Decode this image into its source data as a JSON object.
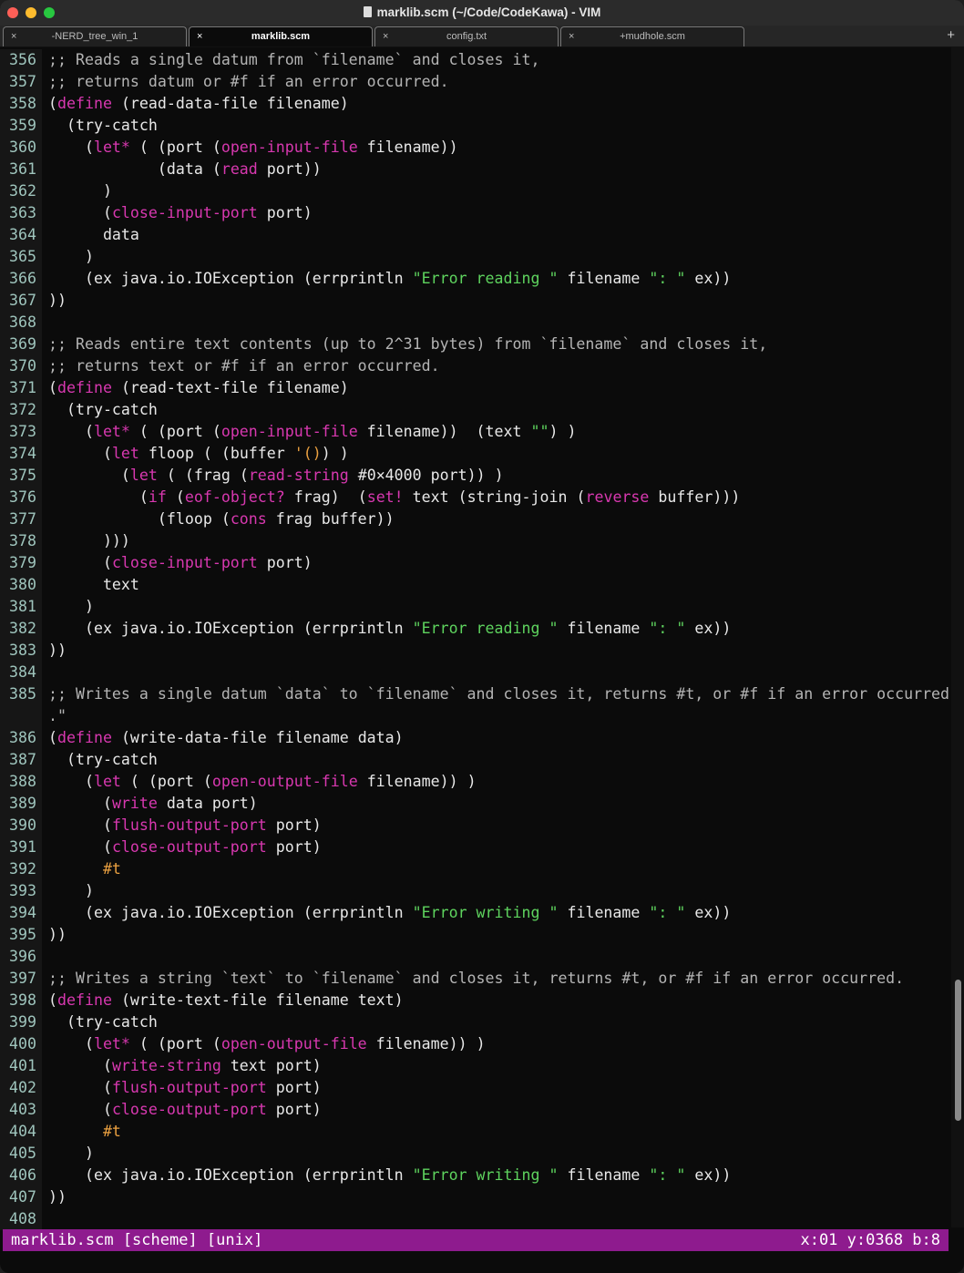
{
  "window": {
    "title": "marklib.scm (~/Code/CodeKawa) - VIM"
  },
  "tabs": [
    {
      "label": "-NERD_tree_win_1",
      "close": "×",
      "active": false
    },
    {
      "label": "marklib.scm",
      "close": "×",
      "active": true
    },
    {
      "label": "config.txt",
      "close": "×",
      "active": false
    },
    {
      "label": "+mudhole.scm",
      "close": "×",
      "active": false
    }
  ],
  "new_tab_label": "+",
  "colors": {
    "statusbar": "#8e1b8e",
    "keyword": "#d838b0",
    "string": "#5ed35e",
    "constant": "#eaa040",
    "comment": "#b4b4b4"
  },
  "scroll": {
    "thumb_start_fraction": 0.79,
    "thumb_size_fraction": 0.12
  },
  "lines": [
    {
      "n": "356",
      "t": [
        [
          "c",
          ";; Reads a single datum from `filename` and closes it,"
        ]
      ]
    },
    {
      "n": "357",
      "t": [
        [
          "c",
          ";; returns datum or #f if an error occurred."
        ]
      ]
    },
    {
      "n": "358",
      "t": [
        [
          "n",
          "("
        ],
        [
          "k",
          "define"
        ],
        [
          "n",
          " (read-data-file filename)"
        ]
      ]
    },
    {
      "n": "359",
      "t": [
        [
          "n",
          "  (try-catch"
        ]
      ]
    },
    {
      "n": "360",
      "t": [
        [
          "n",
          "    ("
        ],
        [
          "k",
          "let*"
        ],
        [
          "n",
          " ( (port ("
        ],
        [
          "k",
          "open-input-file"
        ],
        [
          "n",
          " filename))"
        ]
      ]
    },
    {
      "n": "361",
      "t": [
        [
          "n",
          "            (data ("
        ],
        [
          "k",
          "read"
        ],
        [
          "n",
          " port))"
        ]
      ]
    },
    {
      "n": "362",
      "t": [
        [
          "n",
          "      )"
        ]
      ]
    },
    {
      "n": "363",
      "t": [
        [
          "n",
          "      ("
        ],
        [
          "k",
          "close-input-port"
        ],
        [
          "n",
          " port)"
        ]
      ]
    },
    {
      "n": "364",
      "t": [
        [
          "n",
          "      data"
        ]
      ]
    },
    {
      "n": "365",
      "t": [
        [
          "n",
          "    )"
        ]
      ]
    },
    {
      "n": "366",
      "t": [
        [
          "n",
          "    (ex java.io.IOException (errprintln "
        ],
        [
          "s",
          "\"Error reading \""
        ],
        [
          "n",
          " filename "
        ],
        [
          "s",
          "\": \""
        ],
        [
          "n",
          " ex))"
        ]
      ]
    },
    {
      "n": "367",
      "t": [
        [
          "n",
          "))"
        ]
      ]
    },
    {
      "n": "368",
      "t": []
    },
    {
      "n": "369",
      "t": [
        [
          "c",
          ";; Reads entire text contents (up to 2^31 bytes) from `filename` and closes it,"
        ]
      ]
    },
    {
      "n": "370",
      "t": [
        [
          "c",
          ";; returns text or #f if an error occurred."
        ]
      ]
    },
    {
      "n": "371",
      "t": [
        [
          "n",
          "("
        ],
        [
          "k",
          "define"
        ],
        [
          "n",
          " (read-text-file filename)"
        ]
      ]
    },
    {
      "n": "372",
      "t": [
        [
          "n",
          "  (try-catch"
        ]
      ]
    },
    {
      "n": "373",
      "t": [
        [
          "n",
          "    ("
        ],
        [
          "k",
          "let*"
        ],
        [
          "n",
          " ( (port ("
        ],
        [
          "k",
          "open-input-file"
        ],
        [
          "n",
          " filename))  (text "
        ],
        [
          "s",
          "\"\""
        ],
        [
          "n",
          ") )"
        ]
      ]
    },
    {
      "n": "374",
      "t": [
        [
          "n",
          "      ("
        ],
        [
          "k",
          "let"
        ],
        [
          "n",
          " floop ( (buffer "
        ],
        [
          "o",
          "'()"
        ],
        [
          "n",
          ") )"
        ]
      ]
    },
    {
      "n": "375",
      "t": [
        [
          "n",
          "        ("
        ],
        [
          "k",
          "let"
        ],
        [
          "n",
          " ( (frag ("
        ],
        [
          "k",
          "read-string"
        ],
        [
          "n",
          " #0×4000 port)) )"
        ]
      ]
    },
    {
      "n": "376",
      "t": [
        [
          "n",
          "          ("
        ],
        [
          "k",
          "if"
        ],
        [
          "n",
          " ("
        ],
        [
          "k",
          "eof-object?"
        ],
        [
          "n",
          " frag)  ("
        ],
        [
          "k",
          "set!"
        ],
        [
          "n",
          " text (string-join ("
        ],
        [
          "k",
          "reverse"
        ],
        [
          "n",
          " buffer)))"
        ]
      ]
    },
    {
      "n": "377",
      "t": [
        [
          "n",
          "            (floop ("
        ],
        [
          "k",
          "cons"
        ],
        [
          "n",
          " frag buffer))"
        ]
      ]
    },
    {
      "n": "378",
      "t": [
        [
          "n",
          "      )))"
        ]
      ]
    },
    {
      "n": "379",
      "t": [
        [
          "n",
          "      ("
        ],
        [
          "k",
          "close-input-port"
        ],
        [
          "n",
          " port)"
        ]
      ]
    },
    {
      "n": "380",
      "t": [
        [
          "n",
          "      text"
        ]
      ]
    },
    {
      "n": "381",
      "t": [
        [
          "n",
          "    )"
        ]
      ]
    },
    {
      "n": "382",
      "t": [
        [
          "n",
          "    (ex java.io.IOException (errprintln "
        ],
        [
          "s",
          "\"Error reading \""
        ],
        [
          "n",
          " filename "
        ],
        [
          "s",
          "\": \""
        ],
        [
          "n",
          " ex))"
        ]
      ]
    },
    {
      "n": "383",
      "t": [
        [
          "n",
          "))"
        ]
      ]
    },
    {
      "n": "384",
      "t": []
    },
    {
      "n": "385",
      "t": [
        [
          "c",
          ";; Writes a single datum `data` to `filename` and closes it, returns #t, or #f if an error occurred"
        ]
      ]
    },
    {
      "n": "",
      "t": [
        [
          "c",
          ".\""
        ]
      ]
    },
    {
      "n": "386",
      "t": [
        [
          "n",
          "("
        ],
        [
          "k",
          "define"
        ],
        [
          "n",
          " (write-data-file filename data)"
        ]
      ]
    },
    {
      "n": "387",
      "t": [
        [
          "n",
          "  (try-catch"
        ]
      ]
    },
    {
      "n": "388",
      "t": [
        [
          "n",
          "    ("
        ],
        [
          "k",
          "let"
        ],
        [
          "n",
          " ( (port ("
        ],
        [
          "k",
          "open-output-file"
        ],
        [
          "n",
          " filename)) )"
        ]
      ]
    },
    {
      "n": "389",
      "t": [
        [
          "n",
          "      ("
        ],
        [
          "k",
          "write"
        ],
        [
          "n",
          " data port)"
        ]
      ]
    },
    {
      "n": "390",
      "t": [
        [
          "n",
          "      ("
        ],
        [
          "k",
          "flush-output-port"
        ],
        [
          "n",
          " port)"
        ]
      ]
    },
    {
      "n": "391",
      "t": [
        [
          "n",
          "      ("
        ],
        [
          "k",
          "close-output-port"
        ],
        [
          "n",
          " port)"
        ]
      ]
    },
    {
      "n": "392",
      "t": [
        [
          "o",
          "      #t"
        ]
      ]
    },
    {
      "n": "393",
      "t": [
        [
          "n",
          "    )"
        ]
      ]
    },
    {
      "n": "394",
      "t": [
        [
          "n",
          "    (ex java.io.IOException (errprintln "
        ],
        [
          "s",
          "\"Error writing \""
        ],
        [
          "n",
          " filename "
        ],
        [
          "s",
          "\": \""
        ],
        [
          "n",
          " ex))"
        ]
      ]
    },
    {
      "n": "395",
      "t": [
        [
          "n",
          "))"
        ]
      ]
    },
    {
      "n": "396",
      "t": []
    },
    {
      "n": "397",
      "t": [
        [
          "c",
          ";; Writes a string `text` to `filename` and closes it, returns #t, or #f if an error occurred."
        ]
      ]
    },
    {
      "n": "398",
      "t": [
        [
          "n",
          "("
        ],
        [
          "k",
          "define"
        ],
        [
          "n",
          " (write-text-file filename text)"
        ]
      ]
    },
    {
      "n": "399",
      "t": [
        [
          "n",
          "  (try-catch"
        ]
      ]
    },
    {
      "n": "400",
      "t": [
        [
          "n",
          "    ("
        ],
        [
          "k",
          "let*"
        ],
        [
          "n",
          " ( (port ("
        ],
        [
          "k",
          "open-output-file"
        ],
        [
          "n",
          " filename)) )"
        ]
      ]
    },
    {
      "n": "401",
      "t": [
        [
          "n",
          "      ("
        ],
        [
          "k",
          "write-string"
        ],
        [
          "n",
          " text port)"
        ]
      ]
    },
    {
      "n": "402",
      "t": [
        [
          "n",
          "      ("
        ],
        [
          "k",
          "flush-output-port"
        ],
        [
          "n",
          " port)"
        ]
      ]
    },
    {
      "n": "403",
      "t": [
        [
          "n",
          "      ("
        ],
        [
          "k",
          "close-output-port"
        ],
        [
          "n",
          " port)"
        ]
      ]
    },
    {
      "n": "404",
      "t": [
        [
          "o",
          "      #t"
        ]
      ]
    },
    {
      "n": "405",
      "t": [
        [
          "n",
          "    )"
        ]
      ]
    },
    {
      "n": "406",
      "t": [
        [
          "n",
          "    (ex java.io.IOException (errprintln "
        ],
        [
          "s",
          "\"Error writing \""
        ],
        [
          "n",
          " filename "
        ],
        [
          "s",
          "\": \""
        ],
        [
          "n",
          " ex))"
        ]
      ]
    },
    {
      "n": "407",
      "t": [
        [
          "n",
          "))"
        ]
      ]
    },
    {
      "n": "408",
      "t": []
    }
  ],
  "statusline": {
    "left": "marklib.scm [scheme] [unix]",
    "right": "x:01 y:0368 b:8"
  }
}
